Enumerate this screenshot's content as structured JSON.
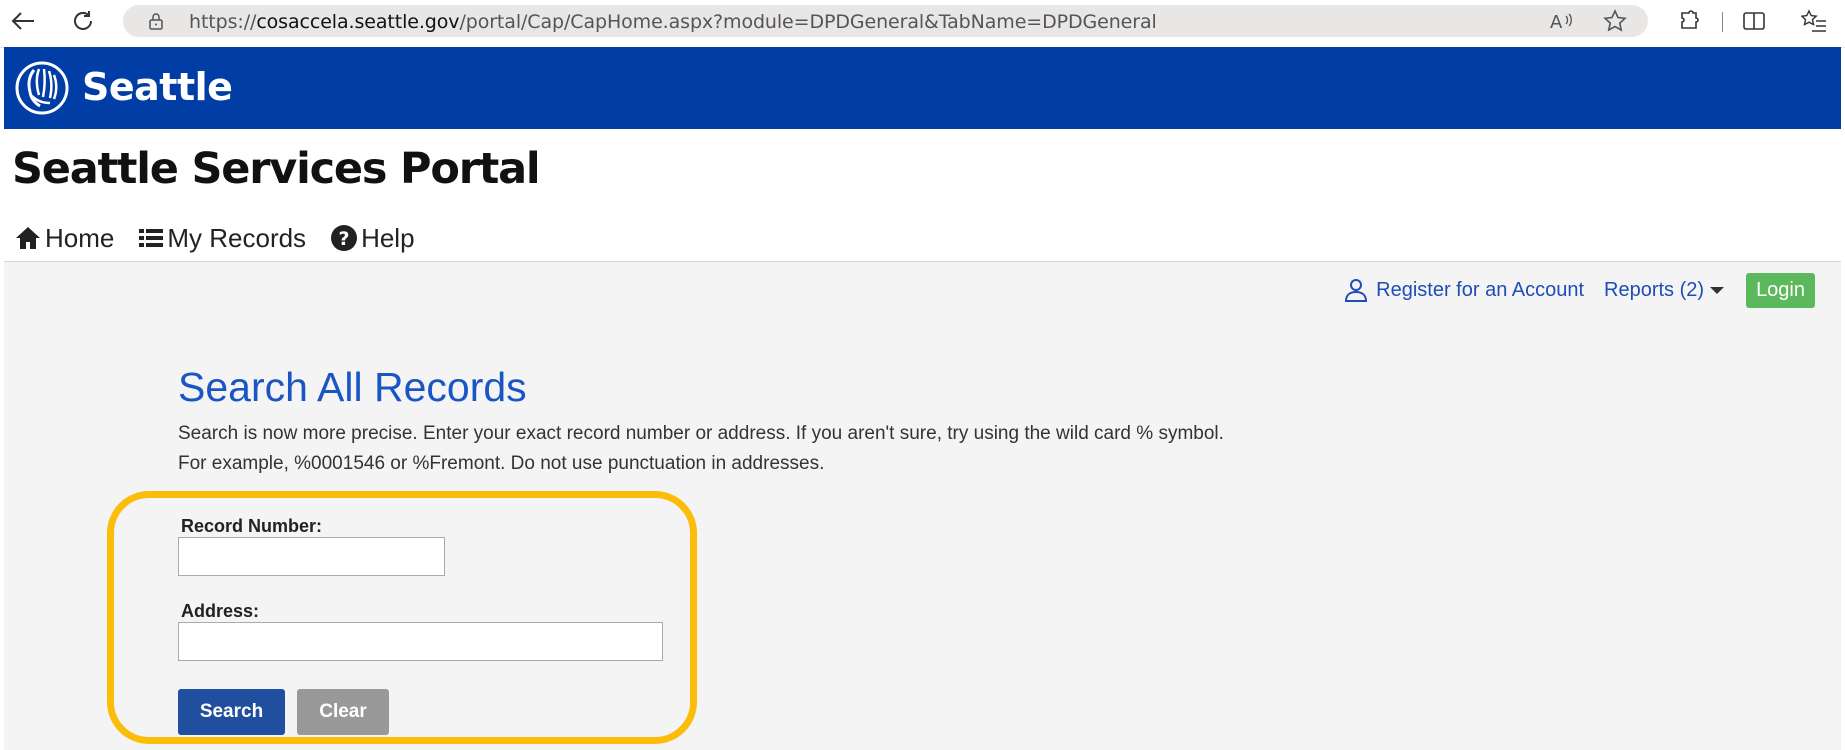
{
  "browser": {
    "url_prefix": "https://",
    "url_host": "cosaccela.seattle.gov",
    "url_path": "/portal/Cap/CapHome.aspx?module=DPDGeneral&TabName=DPDGeneral",
    "icons": [
      "back-icon",
      "refresh-icon",
      "lock-icon",
      "read-aloud-icon",
      "favorite-icon",
      "extensions-icon",
      "split-screen-icon",
      "favorites-list-icon"
    ]
  },
  "header": {
    "city_name": "Seattle",
    "bg_color": "#003da5"
  },
  "portal": {
    "title": "Seattle Services Portal"
  },
  "nav": {
    "items": [
      {
        "label": "Home",
        "icon": "home-icon"
      },
      {
        "label": "My Records",
        "icon": "list-icon"
      },
      {
        "label": "Help",
        "icon": "help-icon"
      }
    ]
  },
  "utility": {
    "register": "Register for an Account",
    "reports": "Reports (2)",
    "login": "Login"
  },
  "search": {
    "title": "Search All Records",
    "desc_line1": "Search is now more precise. Enter your exact record number or address. If you aren't sure, try using the wild card % symbol.",
    "desc_line2": "For example, %0001546 or %Fremont. Do not use punctuation in addresses.",
    "record_label": "Record Number:",
    "record_value": "",
    "address_label": "Address:",
    "address_value": "",
    "search_button": "Search",
    "clear_button": "Clear"
  },
  "colors": {
    "link": "#1e4db7",
    "title_blue": "#1a55c4",
    "login_green": "#5cb85c",
    "search_button": "#1f4f9e",
    "highlight": "#fbbd09"
  }
}
